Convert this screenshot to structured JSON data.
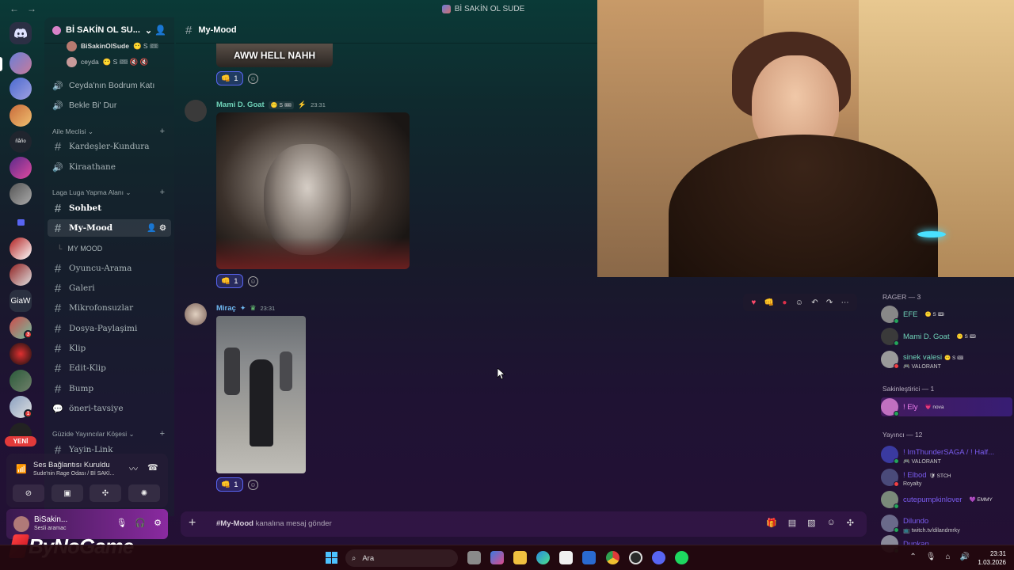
{
  "window": {
    "title": "Bİ SAKİN OL SUDE"
  },
  "server": {
    "name": "Bİ SAKİN OL SU...",
    "dropdown_icon": "chevron-down-icon"
  },
  "sidebar": {
    "voice_users": [
      {
        "name": "BiSakinOlSude",
        "tags": "😶 S 🎟"
      },
      {
        "name": "ceyda",
        "tags": "😶 S 🎟 🔇 🔇"
      }
    ],
    "voice_channels_top": [
      {
        "name": "Ceyda'nın Bodrum Katı"
      },
      {
        "name": "Bekle Bi' Dur"
      }
    ],
    "category_aile": "Aile Meclisi",
    "aile_channels": [
      {
        "name": "Kardeşler-Kundura",
        "type": "text"
      },
      {
        "name": "Kiraathane",
        "type": "voice"
      }
    ],
    "category_laga": "Laga Luga Yapma Alanı",
    "laga_channels": [
      {
        "name": "Sohbet",
        "type": "text"
      },
      {
        "name": "My-Mood",
        "type": "text",
        "selected": true
      },
      {
        "name": "MY MOOD",
        "type": "thread"
      },
      {
        "name": "Oyuncu-Arama",
        "type": "text"
      },
      {
        "name": "Galeri",
        "type": "text"
      },
      {
        "name": "Mikrofonsuzlar",
        "type": "text"
      },
      {
        "name": "Dosya-Paylaşimi",
        "type": "text"
      },
      {
        "name": "Klip",
        "type": "text"
      },
      {
        "name": "Edit-Klip",
        "type": "text"
      },
      {
        "name": "Bump",
        "type": "text"
      },
      {
        "name": "öneri-tavsiye",
        "type": "forum"
      }
    ],
    "category_guzide": "Güzide Yayıncılar Köşesi",
    "guzide_channels": [
      {
        "name": "Yayin-Link",
        "type": "text"
      }
    ]
  },
  "rail": {
    "new_label": "YENİ",
    "giaw_label": "GiaW",
    "notifications": [
      "3",
      "1"
    ]
  },
  "voice_panel": {
    "status": "Ses Bağlantısı Kuruldu",
    "location": "Sude'nin Rage Odası / Bİ SAKİ..."
  },
  "user_panel": {
    "name": "BiSakin...",
    "status": "Sesli aramac"
  },
  "chat": {
    "channel": "My-Mood",
    "messages": [
      {
        "author": "",
        "image_caption": "AWW HELL NAHH",
        "reaction_count": "1"
      },
      {
        "author": "Mami D. Goat",
        "tag": "😶 S 🎟",
        "time": "23:31",
        "author_color": "#6fd2b8",
        "reaction_count": "1"
      },
      {
        "author": "Miraç",
        "tag": "",
        "time": "23:31",
        "author_color": "#6fb8f0",
        "reaction_count": "1"
      }
    ],
    "composer_channel": "#My-Mood",
    "composer_placeholder": " kanalına mesaj gönder"
  },
  "members": {
    "groups": [
      {
        "title": "RAGER — 3",
        "members": [
          {
            "name": "EFE",
            "tag": "😶 S 🎟",
            "sub": "",
            "color": "#6fd2b8",
            "status": "#23a55a"
          },
          {
            "name": "Mami D. Goat",
            "tag": "😶 S 🎟",
            "sub": "",
            "color": "#6fd2b8",
            "status": "#23a55a"
          },
          {
            "name": "sinek valesi",
            "tag": "😶 S 🎟",
            "sub": "🎮 VALORANT",
            "color": "#6fd2b8",
            "status": "#f23f43"
          }
        ]
      },
      {
        "title": "Sakinleştirici — 1",
        "members": [
          {
            "name": "! Ely",
            "tag": "💗 nova",
            "sub": "",
            "color": "#e06ae0",
            "status": "#23a55a"
          }
        ]
      },
      {
        "title": "Yayıncı — 12",
        "members": [
          {
            "name": "! ImThunderSAGA / ! Half...",
            "tag": "",
            "sub": "🎮 VALORANT",
            "color": "#7a5cf0",
            "status": "#23a55a"
          },
          {
            "name": "! Elbod",
            "tag": "🛡 STCH",
            "sub": "Royalty",
            "color": "#7a5cf0",
            "status": "#f23f43"
          },
          {
            "name": "cutepumpkinlover",
            "tag": "💜 EMMY",
            "sub": "",
            "color": "#7a5cf0",
            "status": "#23a55a"
          },
          {
            "name": "Dilundo",
            "tag": "",
            "sub": "📺 twitch.tv/dilandmrky",
            "color": "#7a5cf0",
            "status": "#23a55a"
          },
          {
            "name": "Dunkan",
            "tag": "",
            "sub": "",
            "color": "#7a5cf0",
            "status": "#23a55a"
          }
        ]
      }
    ]
  },
  "logo": {
    "text": "ByNoGame"
  },
  "taskbar": {
    "search": "Ara",
    "time": "23:31",
    "date": "1.03.2026"
  },
  "colors": {
    "accent": "#5865f2",
    "red": "#e23a3a"
  }
}
